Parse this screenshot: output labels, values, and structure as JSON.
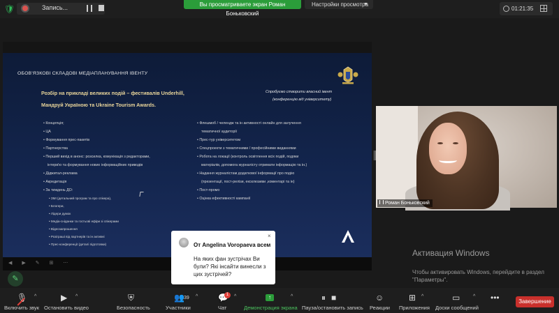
{
  "top_bar": {
    "recording_label": "Запись...",
    "share_banner": "Вы просматриваете экран Роман Боньковский",
    "view_settings": "Настройки просмотра",
    "timer": "01:21:35"
  },
  "slide": {
    "heading": "ОБОВ'ЯЗКОВІ СКЛАДОВІ МЕДІАПЛАНУВАННЯ ІВЕНТУ",
    "subtitle_line1": "Розбір на прикладі великих подій – фестивалів Underhill,",
    "subtitle_line2": "Мандруй Україною та Ukraine Tourism Awards.",
    "note_line1": "Спробуємо створити власний івент",
    "note_line2": "(конференцію від університету)",
    "left_items": [
      "Концепція;",
      "ЦА",
      "Формування прес-пакетів",
      "Партнерства",
      "Перший вихід в анонс: розсилка, комунікація з редакторами,",
      "інтерв'ю та формування нових інформаційних приводів",
      "Діджитал-реклама",
      "Акредитація",
      "За тиждень ДО:"
    ],
    "left_subitems": [
      "ЗМІ (детальний програм та про спікера),",
      "Блогери,",
      "Лідери думок",
      "Медіа-сніданки та гостьові ефіри зі спікерами",
      "Відеозапрошення",
      "Розіграші від партнерів та ін активні",
      "Прес-конференції (деталі підготовки)"
    ],
    "right_items": [
      "Флешмоб / челендж та ін активності онлайн для залучення",
      "тематичної аудиторії",
      "Прес-тур університетом",
      "Спецпроекти з тематичними / професійними виданнями",
      "Робота на локації (контроль освітлення всіх подій, подяки",
      "матеріалів, допомога журналісту отримати інформацію та ін.)",
      "Надання журналістам додаткової інформації про подію",
      "(презентації, пост-релізи, ексклюзиви ,коментарі та ін)",
      "Пост-промо",
      "Оцінка ефективності кампанії"
    ]
  },
  "video": {
    "participant_name": "Роман Боньковский"
  },
  "chat_popup": {
    "title": "От Angelina Voropaeva всем",
    "message": "На яких фан зустрічах Ви були? Які інсайти винесли з цих зустрічей?",
    "close_symbol": "×"
  },
  "watermark": {
    "title": "Активация Windows",
    "subtitle": "Чтобы активировать Windows, перейдите в раздел \"Параметры\"."
  },
  "toolbar": {
    "mute": "Включить звук",
    "video": "Остановить видео",
    "security": "Безопасность",
    "participants": "Участники",
    "participants_count": "39",
    "chat": "Чат",
    "chat_badge": "1",
    "share": "Демонстрация экрана",
    "pause_share": "Пауза/остановить запись",
    "reactions": "Реакции",
    "apps": "Приложения",
    "whiteboards": "Доски сообщений",
    "more": "Подробнее",
    "end": "Завершение"
  },
  "colors": {
    "share_green": "#2b9d3a",
    "end_red": "#c9302c",
    "slide_navy": "#13254d",
    "slide_gold": "#e8d49a"
  }
}
